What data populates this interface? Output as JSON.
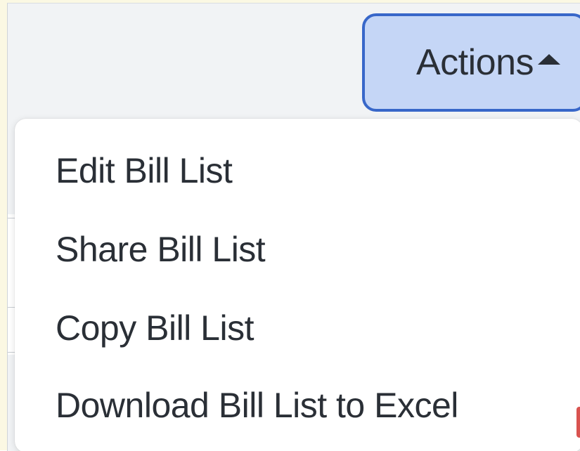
{
  "actions_button": {
    "label": "Actions",
    "icon": "caret-up-icon"
  },
  "menu": {
    "items": [
      {
        "label": "Edit Bill List"
      },
      {
        "label": "Share Bill List"
      },
      {
        "label": "Copy Bill List"
      },
      {
        "label": "Download Bill List to Excel"
      }
    ]
  },
  "colors": {
    "page_background": "#f1f3f5",
    "outer_border": "#fbf8e3",
    "button_fill": "#c5d6f6",
    "button_border": "#3867c9",
    "text": "#2a2f36",
    "menu_background": "#ffffff"
  }
}
